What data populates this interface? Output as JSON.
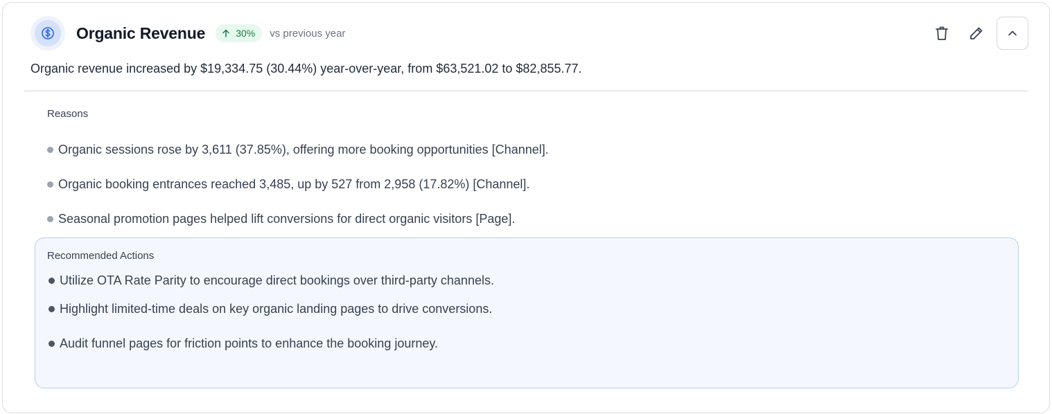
{
  "insight": {
    "icon": "dollar-icon",
    "title": "Organic Revenue",
    "badge": {
      "value": "30%",
      "direction": "up",
      "color": "#15803d"
    },
    "comparison": "vs previous year",
    "summary": "Organic revenue increased by $19,334.75 (30.44%) year-over-year, from $63,521.02 to $82,855.77."
  },
  "toolbar": {
    "delete_icon": "trash-icon",
    "edit_icon": "pencil-icon",
    "collapse_icon": "chevron-up-icon"
  },
  "reasons": {
    "label": "Reasons",
    "items": [
      "Organic sessions rose by 3,611 (37.85%), offering more booking opportunities [Channel].",
      "Organic booking entrances reached 3,485, up by 527 from 2,958 (17.82%) [Channel].",
      "Seasonal promotion pages helped lift conversions for direct organic visitors [Page]."
    ]
  },
  "recommended_actions": {
    "label": "Recommended Actions",
    "items": [
      "Utilize OTA Rate Parity to encourage direct bookings over third-party channels.",
      "Highlight limited-time deals on key organic landing pages to drive conversions.",
      "Audit funnel pages for friction points to enhance the booking journey."
    ]
  },
  "colors": {
    "accent": "#2563eb",
    "positive": "#15803d",
    "panel_bg": "#f4f7fd",
    "panel_border": "#b9cdf0"
  }
}
